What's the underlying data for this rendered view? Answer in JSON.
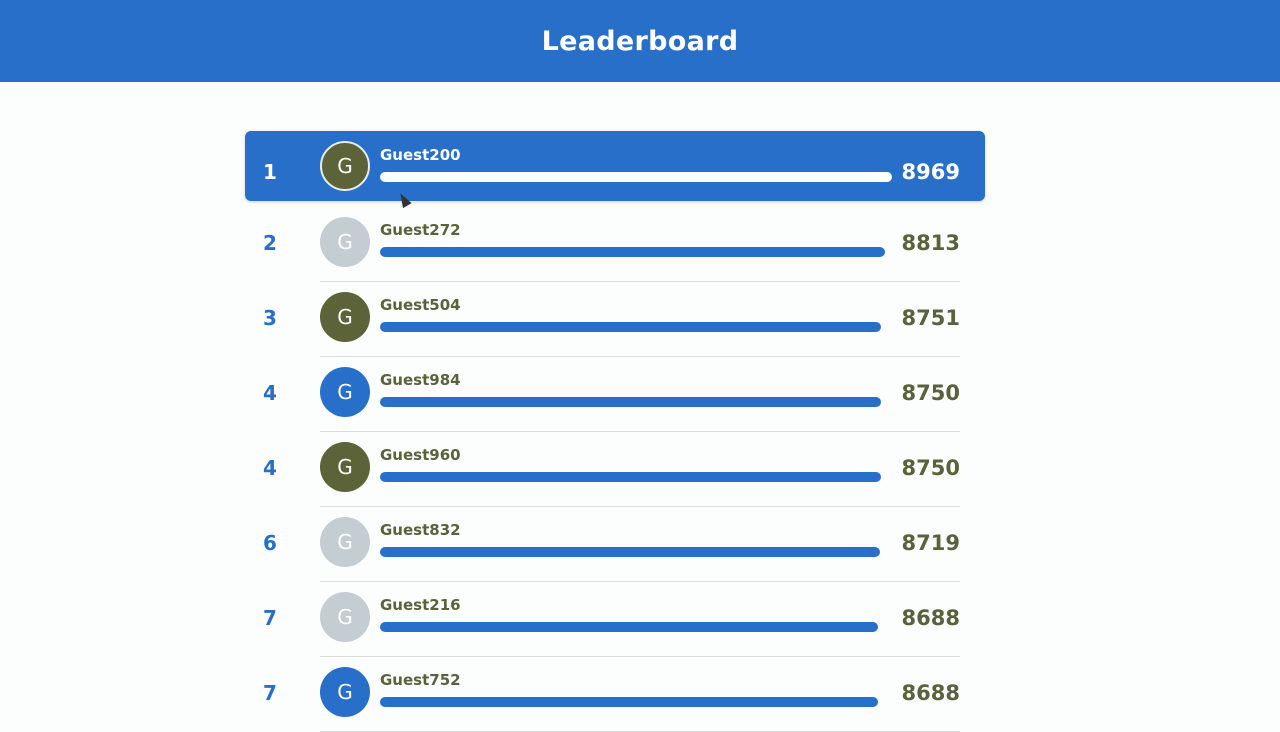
{
  "header": {
    "title": "Leaderboard"
  },
  "colors": {
    "accent": "#276fc8",
    "olive": "#5c6338",
    "grey": "#c4cdd2"
  },
  "entries": [
    {
      "rank": "1",
      "initial": "G",
      "name": "Guest200",
      "score": "8969",
      "avatar_color": "#5c6338",
      "bar_fraction": 1.0
    },
    {
      "rank": "2",
      "initial": "G",
      "name": "Guest272",
      "score": "8813",
      "avatar_color": "#c4cdd2",
      "bar_fraction": 0.9826
    },
    {
      "rank": "3",
      "initial": "G",
      "name": "Guest504",
      "score": "8751",
      "avatar_color": "#5c6338",
      "bar_fraction": 0.9757
    },
    {
      "rank": "4",
      "initial": "G",
      "name": "Guest984",
      "score": "8750",
      "avatar_color": "#276fc8",
      "bar_fraction": 0.9756
    },
    {
      "rank": "4",
      "initial": "G",
      "name": "Guest960",
      "score": "8750",
      "avatar_color": "#5c6338",
      "bar_fraction": 0.9756
    },
    {
      "rank": "6",
      "initial": "G",
      "name": "Guest832",
      "score": "8719",
      "avatar_color": "#c4cdd2",
      "bar_fraction": 0.9721
    },
    {
      "rank": "7",
      "initial": "G",
      "name": "Guest216",
      "score": "8688",
      "avatar_color": "#c4cdd2",
      "bar_fraction": 0.9687
    },
    {
      "rank": "7",
      "initial": "G",
      "name": "Guest752",
      "score": "8688",
      "avatar_color": "#276fc8",
      "bar_fraction": 0.9687
    }
  ]
}
